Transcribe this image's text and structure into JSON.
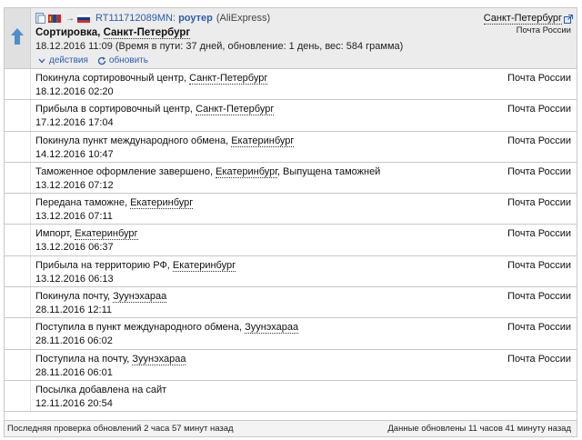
{
  "header": {
    "track_number": "RT111712089MN:",
    "item_name": "роутер",
    "shop": "(AliExpress)",
    "status_prefix": "Сортировка, ",
    "status_city": "Санкт-Петербург",
    "meta": "18.12.2016 11:09 (Время в пути: 37 дней, обновление: 1 день, вес: 584 грамма)",
    "actions_label": "действия",
    "refresh_label": "обновить",
    "dest_city": "Санкт-Петербург",
    "carrier": "Почта России"
  },
  "events": [
    {
      "text": "Покинула сортировочный центр, ",
      "place": "Санкт-Петербург",
      "suffix": "",
      "time": "18.12.2016 02:20",
      "carrier": "Почта России"
    },
    {
      "text": "Прибыла в сортировочный центр, ",
      "place": "Санкт-Петербург",
      "suffix": "",
      "time": "17.12.2016 17:04",
      "carrier": "Почта России"
    },
    {
      "text": "Покинула пункт международного обмена, ",
      "place": "Екатеринбург",
      "suffix": "",
      "time": "14.12.2016 10:47",
      "carrier": "Почта России"
    },
    {
      "text": "Таможенное оформление завершено, ",
      "place": "Екатеринбург",
      "suffix": ", Выпущена таможней",
      "time": "13.12.2016 07:12",
      "carrier": "Почта России"
    },
    {
      "text": "Передана таможне, ",
      "place": "Екатеринбург",
      "suffix": "",
      "time": "13.12.2016 07:11",
      "carrier": "Почта России"
    },
    {
      "text": "Импорт, ",
      "place": "Екатеринбург",
      "suffix": "",
      "time": "13.12.2016 06:37",
      "carrier": "Почта России"
    },
    {
      "text": "Прибыла на территорию РФ, ",
      "place": "Екатеринбург",
      "suffix": "",
      "time": "13.12.2016 06:13",
      "carrier": "Почта России"
    },
    {
      "text": "Покинула почту, ",
      "place": "Зуунэхараа",
      "suffix": "",
      "time": "28.11.2016 12:11",
      "carrier": "Почта России"
    },
    {
      "text": "Поступила в пункт международного обмена, ",
      "place": "Зуунэхараа",
      "suffix": "",
      "time": "28.11.2016 06:02",
      "carrier": "Почта России"
    },
    {
      "text": "Поступила на почту, ",
      "place": "Зуунэхараа",
      "suffix": "",
      "time": "28.11.2016 06:01",
      "carrier": "Почта России"
    },
    {
      "text": "Посылка добавлена на сайт",
      "place": "",
      "suffix": "",
      "time": "12.11.2016 20:54",
      "carrier": ""
    }
  ],
  "footer": {
    "left": "Последняя проверка обновлений 2 часа 57 минут назад",
    "right": "Данные обновлены 11 часов 41 минуту назад"
  },
  "colors": {
    "link": "#2a5db0",
    "up_arrow": "#4a8fd0",
    "header_bg": "#ececec"
  },
  "icons": {
    "up": "up-arrow-icon",
    "doc": "document-icon",
    "origin_flag": "mongolia-flag-icon",
    "dest_flag": "russia-flag-icon",
    "external": "external-link-icon",
    "chevron": "chevron-down-icon",
    "refresh": "refresh-icon"
  }
}
